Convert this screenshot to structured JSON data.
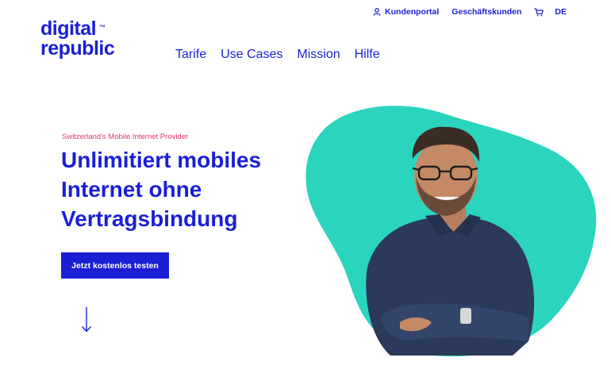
{
  "brand": {
    "line1": "digital",
    "line2": "republic",
    "trademark": "™"
  },
  "utility_nav": {
    "customer_portal": "Kundenportal",
    "business": "Geschäftskunden",
    "language": "DE",
    "icons": [
      "user-icon",
      "cart-icon"
    ]
  },
  "main_nav": [
    {
      "label": "Tarife"
    },
    {
      "label": "Use Cases"
    },
    {
      "label": "Mission"
    },
    {
      "label": "Hilfe"
    }
  ],
  "hero": {
    "eyebrow": "Switzerland's Mobile Internet Provider",
    "headline_lines": [
      "Unlimitiert mobiles",
      "Internet ohne",
      "Vertragsbindung"
    ],
    "cta_label": "Jetzt kostenlos testen",
    "scroll_icon": "arrow-down-icon"
  },
  "colors": {
    "brand": "#1a1fd6",
    "accent": "#e0336b",
    "blob": "#2bd4bd",
    "shirt": "#2b3a5a"
  }
}
